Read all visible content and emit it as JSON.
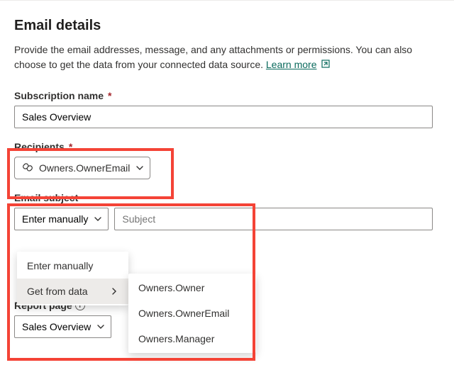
{
  "title": "Email details",
  "description_line1": "Provide the email addresses, message, and any attachments or permissions. You can also choose to get the data from your connected data source. ",
  "learn_more": "Learn more",
  "subscription": {
    "label": "Subscription name",
    "value": "Sales Overview"
  },
  "recipients": {
    "label": "Recipients",
    "chip_value": "Owners.OwnerEmail"
  },
  "email_subject": {
    "label": "Email subject",
    "source_selected": "Enter manually",
    "placeholder": "Subject",
    "value": ""
  },
  "source_menu": {
    "items": [
      "Enter manually",
      "Get from data"
    ]
  },
  "data_submenu": {
    "items": [
      "Owners.Owner",
      "Owners.OwnerEmail",
      "Owners.Manager"
    ]
  },
  "report_page": {
    "label": "Report page",
    "selected": "Sales Overview"
  }
}
